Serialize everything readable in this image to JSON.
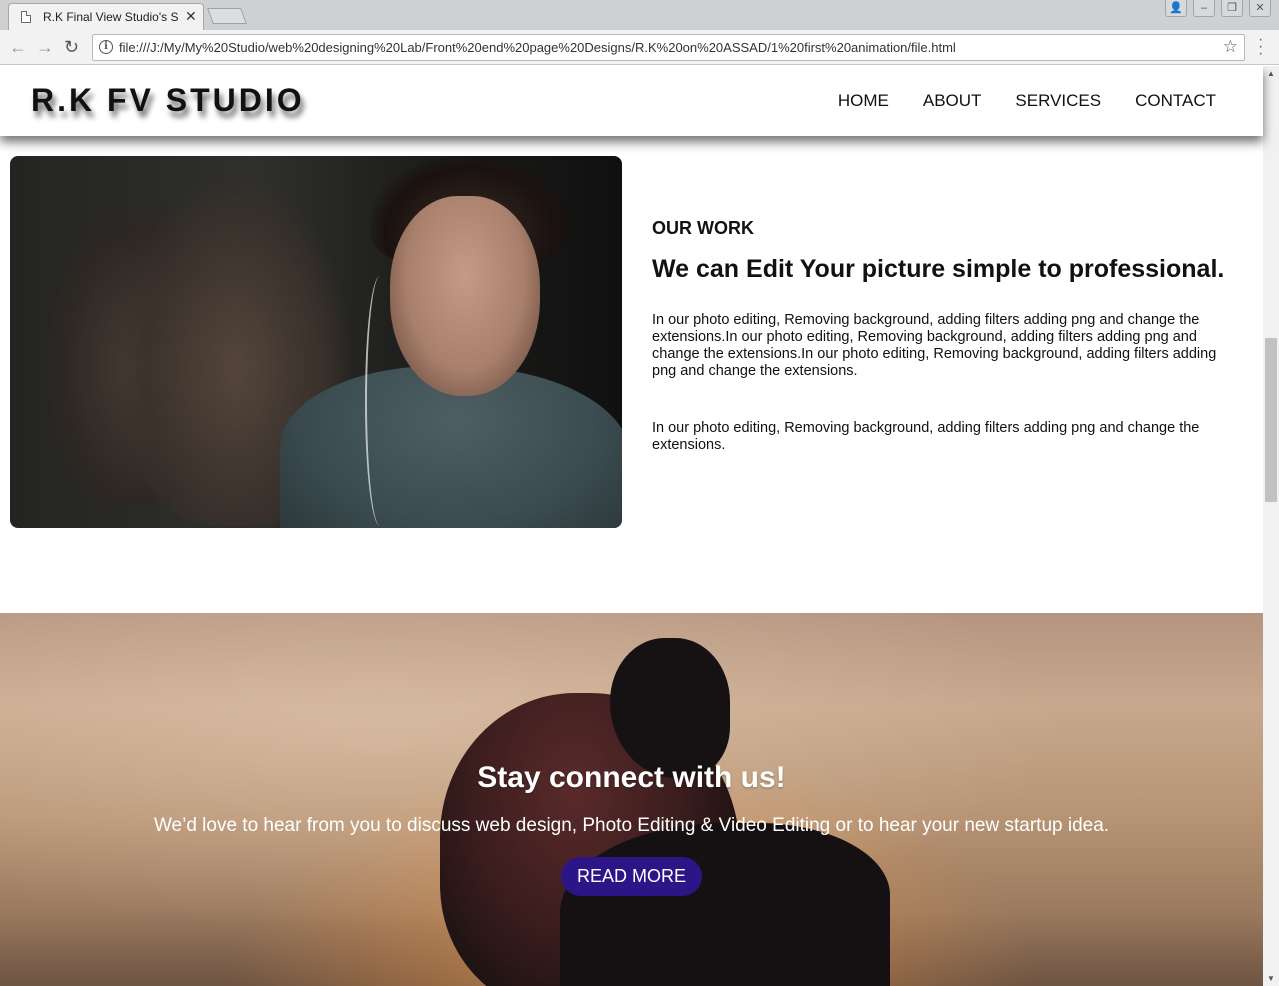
{
  "browser": {
    "tab_title": "R.K Final View Studio's S",
    "url": "file:///J:/My/My%20Studio/web%20designing%20Lab/Front%20end%20page%20Designs/R.K%20on%20ASSAD/1%20first%20animation/file.html"
  },
  "site": {
    "logo": "R.K FV STUDIO",
    "nav": [
      "HOME",
      "ABOUT",
      "SERVICES",
      "CONTACT"
    ]
  },
  "work": {
    "kicker": "OUR WORK",
    "heading": "We can Edit Your picture simple to professional.",
    "paragraph1": "In our photo editing, Removing background, adding filters adding png and change the extensions.In our photo editing, Removing background, adding filters adding png and change the extensions.In our photo editing, Removing background, adding filters adding png and change the extensions.",
    "paragraph2": "In our photo editing, Removing background, adding filters adding png and change the extensions."
  },
  "contact": {
    "heading": "Stay connect with us!",
    "text": "We’d love to hear from you to discuss web design, Photo Editing & Video Editing or to hear your new startup idea.",
    "button": "READ MORE",
    "button_color": "#2c1587"
  },
  "icons": {
    "page": "page-icon",
    "close": "close-icon",
    "back": "back-arrow-icon",
    "forward": "forward-arrow-icon",
    "reload": "reload-icon",
    "info": "info-icon",
    "star": "bookmark-star-icon",
    "menu": "menu-dots-icon"
  }
}
